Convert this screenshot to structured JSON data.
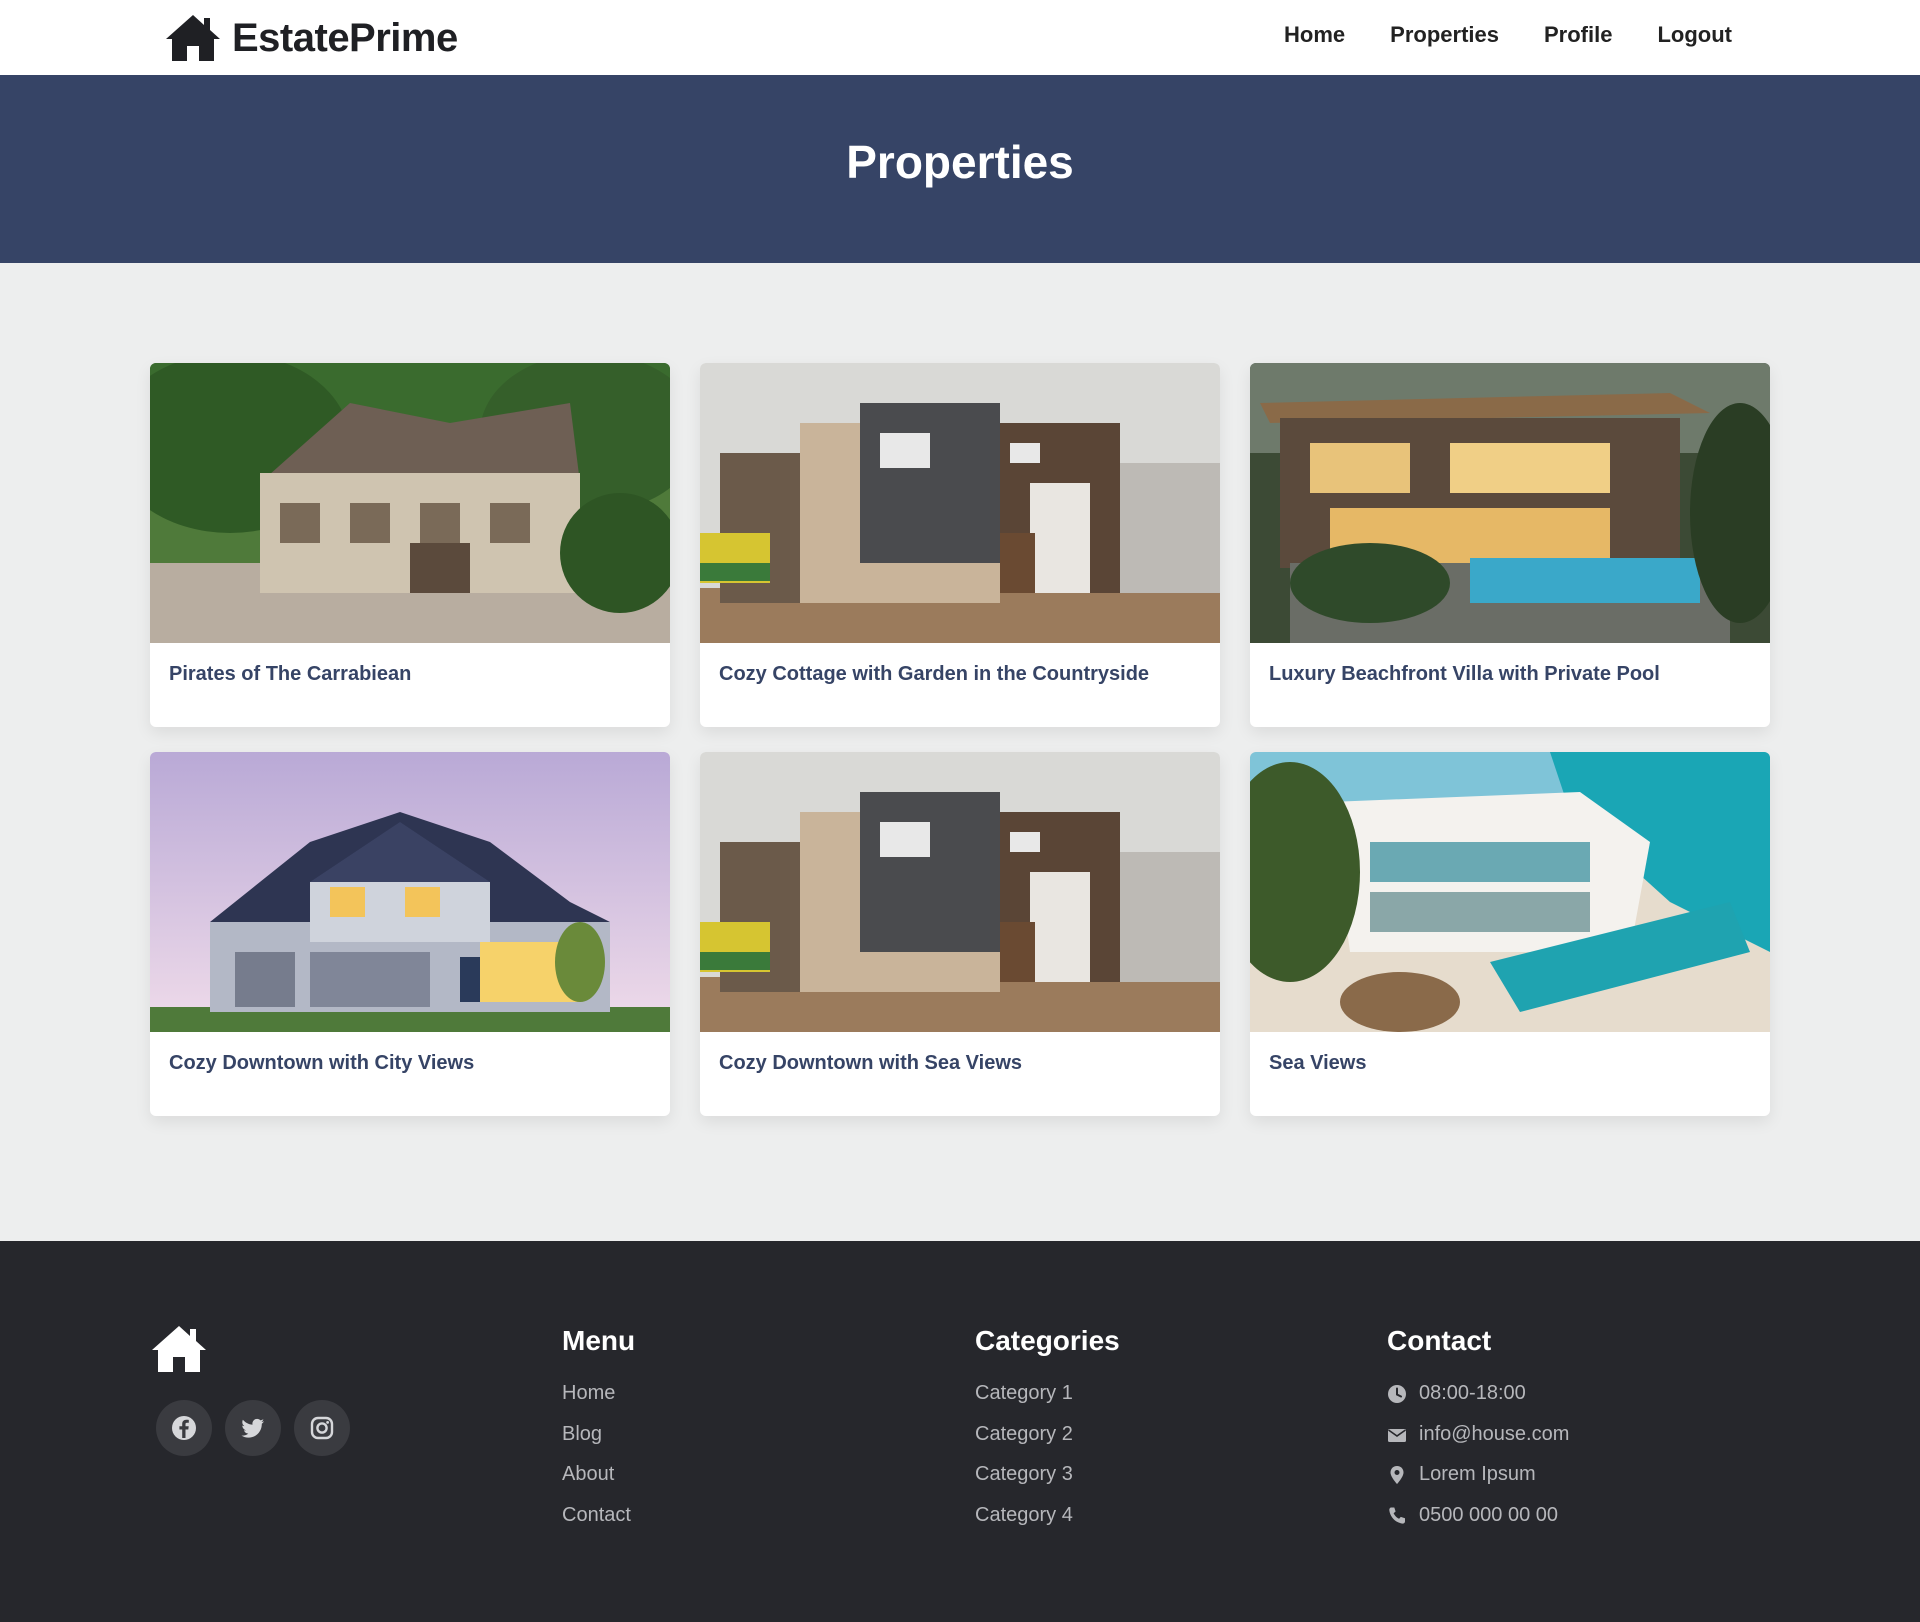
{
  "brand": {
    "name": "EstatePrime",
    "icon": "home-icon"
  },
  "nav": {
    "items": [
      "Home",
      "Properties",
      "Profile",
      "Logout"
    ]
  },
  "hero": {
    "title": "Properties"
  },
  "properties": [
    {
      "title": "Pirates of The Carrabiean",
      "image": "tudor-house-photo"
    },
    {
      "title": "Cozy Cottage with Garden in the Countryside",
      "image": "modern-townhouse-photo"
    },
    {
      "title": "Luxury Beachfront Villa with Private Pool",
      "image": "pool-villa-photo"
    },
    {
      "title": "Cozy Downtown with City Views",
      "image": "suburban-house-photo"
    },
    {
      "title": "Cozy Downtown with Sea Views",
      "image": "modern-townhouse-photo"
    },
    {
      "title": "Sea Views",
      "image": "beach-villa-photo"
    }
  ],
  "footer": {
    "logo_icon": "home-icon",
    "social": [
      "facebook-icon",
      "twitter-icon",
      "instagram-icon"
    ],
    "menu": {
      "title": "Menu",
      "items": [
        "Home",
        "Blog",
        "About",
        "Contact"
      ]
    },
    "categories": {
      "title": "Categories",
      "items": [
        "Category 1",
        "Category 2",
        "Category 3",
        "Category 4"
      ]
    },
    "contact": {
      "title": "Contact",
      "hours": "08:00-18:00",
      "email": "info@house.com",
      "address": "Lorem Ipsum",
      "phone": "0500 000 00 00"
    }
  },
  "colors": {
    "hero_bg": "#364466",
    "footer_bg": "#26272c",
    "card_title": "#364466"
  }
}
